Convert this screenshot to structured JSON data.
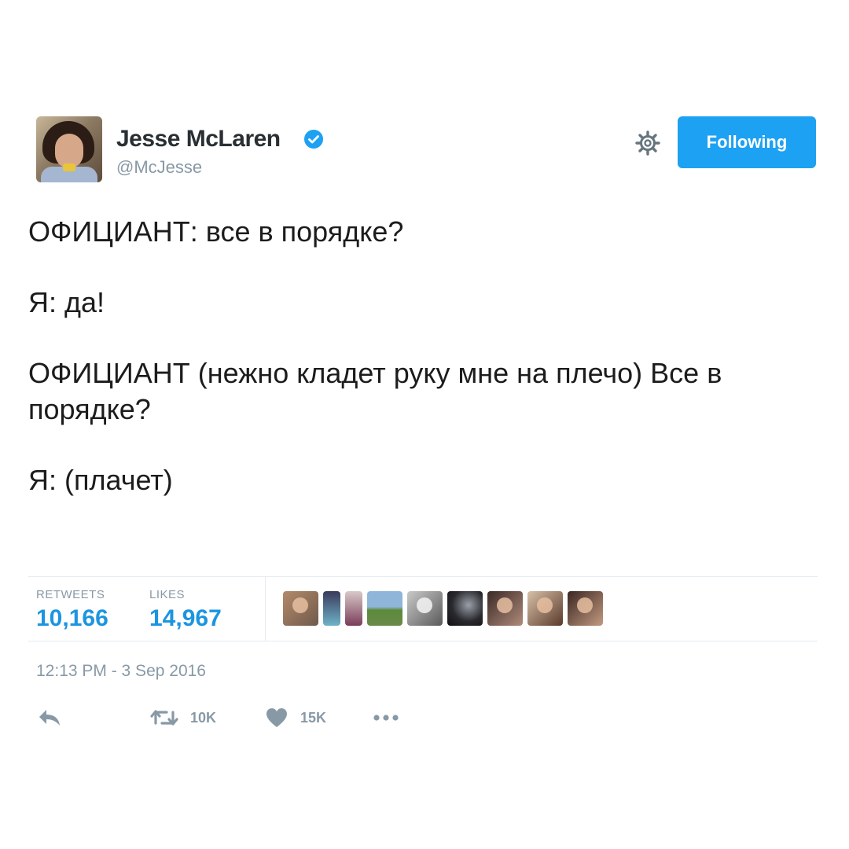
{
  "tweet": {
    "author": {
      "name": "Jesse McLaren",
      "handle": "@McJesse",
      "verified": true
    },
    "follow_button_label": "Following",
    "text_blocks": [
      "ОФИЦИАНТ: все в порядке?",
      "Я: да!",
      "ОФИЦИАНТ (нежно кладет руку мне на плечо) Все в порядке?",
      "Я: (плачет)"
    ],
    "stats": {
      "retweets_label": "RETWEETS",
      "retweets_value": "10,166",
      "likes_label": "LIKES",
      "likes_value": "14,967"
    },
    "timestamp": "12:13 PM - 3 Sep 2016",
    "actions": {
      "reply_icon": "reply-icon",
      "retweet_icon": "retweet-icon",
      "retweet_count": "10K",
      "like_icon": "heart-icon",
      "like_count": "15K",
      "more_icon": "more-icon"
    }
  },
  "colors": {
    "accent": "#1da1f2",
    "stat_value": "#1b95e0",
    "muted": "#8899a6",
    "text": "#1c1c1c"
  }
}
